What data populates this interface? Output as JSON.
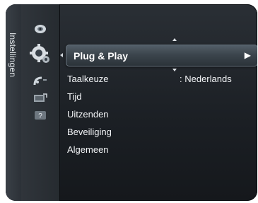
{
  "sidebar": {
    "title": "Instellingen"
  },
  "icons": [
    "picture-icon",
    "settings-gear-icon",
    "satellite-icon",
    "input-icon",
    "help-icon"
  ],
  "menu": {
    "selected": {
      "label": "Plug & Play",
      "arrow": "▶"
    },
    "items": [
      {
        "label": "Taalkeuze",
        "value": ": Nederlands"
      },
      {
        "label": "Tijd"
      },
      {
        "label": "Uitzenden"
      },
      {
        "label": "Beveiliging"
      },
      {
        "label": "Algemeen"
      }
    ]
  },
  "colors": {
    "panel": "#1b1f24",
    "highlight": "#4a545c",
    "text": "#f2f4f6"
  }
}
